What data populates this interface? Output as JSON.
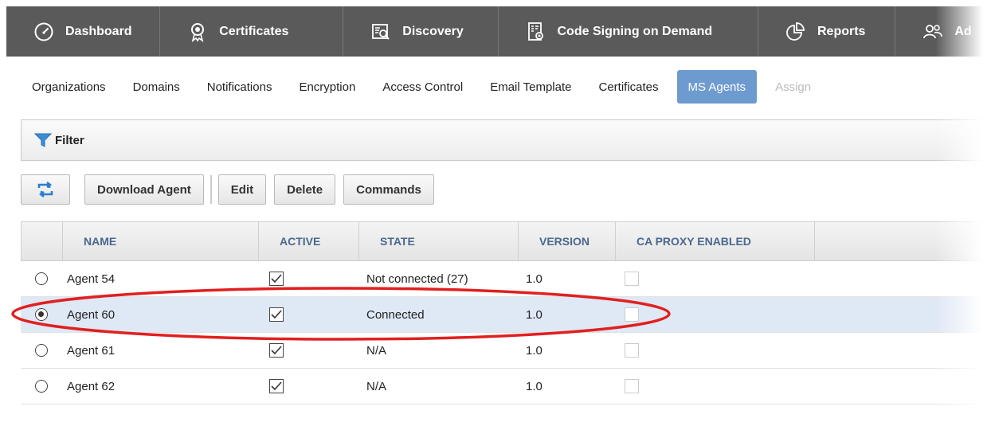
{
  "top_nav": {
    "tabs": [
      {
        "label": "Dashboard",
        "icon": "dashboard-gauge-icon"
      },
      {
        "label": "Certificates",
        "icon": "certificate-badge-icon"
      },
      {
        "label": "Discovery",
        "icon": "discovery-search-icon"
      },
      {
        "label": "Code Signing on Demand",
        "icon": "code-signing-icon"
      },
      {
        "label": "Reports",
        "icon": "reports-pie-icon"
      },
      {
        "label": "Ad",
        "icon": "admins-users-icon"
      }
    ]
  },
  "sub_nav": {
    "items": [
      {
        "label": "Organizations"
      },
      {
        "label": "Domains"
      },
      {
        "label": "Notifications"
      },
      {
        "label": "Encryption"
      },
      {
        "label": "Access Control"
      },
      {
        "label": "Email Template"
      },
      {
        "label": "Certificates"
      },
      {
        "label": "MS Agents",
        "active": true
      },
      {
        "label": "Assign"
      }
    ]
  },
  "filter": {
    "label": "Filter",
    "icon": "filter-funnel-icon"
  },
  "toolbar": {
    "refresh_icon": "refresh-icon",
    "download_agent": "Download Agent",
    "edit": "Edit",
    "delete": "Delete",
    "commands": "Commands"
  },
  "table": {
    "columns": [
      "NAME",
      "ACTIVE",
      "STATE",
      "VERSION",
      "CA PROXY ENABLED"
    ],
    "rows": [
      {
        "name": "Agent 54",
        "active": true,
        "state": "Not connected (27)",
        "version": "1.0",
        "ca_proxy": false,
        "selected": false
      },
      {
        "name": "Agent 60",
        "active": true,
        "state": "Connected",
        "version": "1.0",
        "ca_proxy": false,
        "selected": true
      },
      {
        "name": "Agent 61",
        "active": true,
        "state": "N/A",
        "version": "1.0",
        "ca_proxy": false,
        "selected": false
      },
      {
        "name": "Agent 62",
        "active": true,
        "state": "N/A",
        "version": "1.0",
        "ca_proxy": false,
        "selected": false
      }
    ]
  },
  "colors": {
    "nav_bg": "#5a5a5a",
    "active_tab": "#6e9bcf",
    "header_text": "#4a6890",
    "selected_row": "#dfe8f5",
    "annotation": "#e02020"
  }
}
